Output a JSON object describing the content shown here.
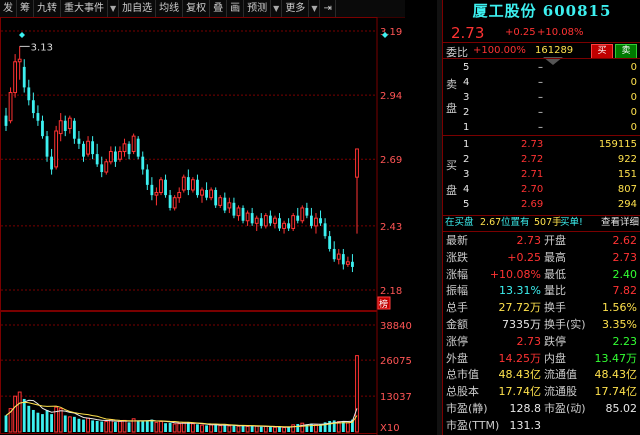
{
  "toolbar": {
    "items": [
      "发",
      "筹",
      "九转",
      "重大事件",
      "",
      "加自选",
      "均线",
      "复权",
      "叠",
      "画",
      "预测",
      "",
      "更多",
      "",
      ""
    ],
    "arrow_down": "▼",
    "more_arrow": "▼",
    "pin_icon": "⇥",
    "dropdown_icon": "▼"
  },
  "chart": {
    "price_labels": [
      "3.19",
      "2.94",
      "2.69",
      "2.43",
      "2.18"
    ],
    "volume_labels": [
      "38840",
      "26075",
      "13037",
      "X10"
    ],
    "max_label": "3.13",
    "badge": "榜"
  },
  "quote": {
    "title": "厦工股份 600815",
    "price": "2.73",
    "change": "+0.25",
    "change_pct": "+10.08%",
    "ratio_label": "委比",
    "ratio_pct": "+100.00%",
    "ratio_vol": "161289",
    "buy_btn": "买",
    "sell_btn": "卖",
    "sell_side": "卖盘",
    "buy_side": "买盘",
    "sell_orders": [
      {
        "level": "5",
        "price": "–",
        "vol": "0"
      },
      {
        "level": "4",
        "price": "–",
        "vol": "0"
      },
      {
        "level": "3",
        "price": "–",
        "vol": "0"
      },
      {
        "level": "2",
        "price": "–",
        "vol": "0"
      },
      {
        "level": "1",
        "price": "–",
        "vol": "0"
      }
    ],
    "buy_orders": [
      {
        "level": "1",
        "price": "2.73",
        "vol": "159115"
      },
      {
        "level": "2",
        "price": "2.72",
        "vol": "922"
      },
      {
        "level": "3",
        "price": "2.71",
        "vol": "151"
      },
      {
        "level": "4",
        "price": "2.70",
        "vol": "807"
      },
      {
        "level": "5",
        "price": "2.69",
        "vol": "294"
      }
    ],
    "notice_prefix": "在买盘",
    "notice_price": "2.67",
    "notice_mid": "位置有",
    "notice_vol": "507手",
    "notice_suffix": "买单!",
    "detail_link": "查看详细",
    "stats": [
      {
        "l1": "最新",
        "v1": "2.73",
        "c1": "red",
        "l2": "开盘",
        "v2": "2.62",
        "c2": "red"
      },
      {
        "l1": "涨跌",
        "v1": "+0.25",
        "c1": "red",
        "l2": "最高",
        "v2": "2.73",
        "c2": "red"
      },
      {
        "l1": "涨幅",
        "v1": "+10.08%",
        "c1": "red",
        "l2": "最低",
        "v2": "2.40",
        "c2": "green"
      },
      {
        "l1": "振幅",
        "v1": "13.31%",
        "c1": "cyan",
        "l2": "量比",
        "v2": "7.82",
        "c2": "red"
      },
      {
        "l1": "总手",
        "v1": "27.72万",
        "c1": "yellow",
        "l2": "换手",
        "v2": "1.56%",
        "c2": "yellow"
      },
      {
        "l1": "金额",
        "v1": "7335万",
        "c1": "white",
        "l2": "换手(实)",
        "v2": "3.35%",
        "c2": "yellow"
      },
      {
        "l1": "涨停",
        "v1": "2.73",
        "c1": "red",
        "l2": "跌停",
        "v2": "2.23",
        "c2": "green"
      },
      {
        "l1": "外盘",
        "v1": "14.25万",
        "c1": "red",
        "l2": "内盘",
        "v2": "13.47万",
        "c2": "green"
      },
      {
        "l1": "总市值",
        "v1": "48.43亿",
        "c1": "yellow",
        "l2": "流通值",
        "v2": "48.43亿",
        "c2": "yellow"
      },
      {
        "l1": "总股本",
        "v1": "17.74亿",
        "c1": "yellow",
        "l2": "流通股",
        "v2": "17.74亿",
        "c2": "yellow"
      },
      {
        "l1": "市盈(静)",
        "v1": "128.8",
        "c1": "white",
        "l2": "市盈(动)",
        "v2": "85.02",
        "c2": "white"
      },
      {
        "l1": "市盈(TTM)",
        "v1": "131.3",
        "c1": "white",
        "l2": "",
        "v2": "",
        "c2": "white"
      }
    ]
  },
  "colors": {
    "up": "#ff3333",
    "down": "#3df0f0",
    "grid": "#7a0000",
    "ma5": "#e8e8e8",
    "ma10": "#ffe24d",
    "ma20": "#ff66ff"
  },
  "chart_data": {
    "type": "candlestick",
    "ylim": [
      2.18,
      3.19
    ],
    "volume_ylim": [
      0,
      38840
    ],
    "candles": [
      {
        "o": 2.86,
        "h": 2.89,
        "l": 2.8,
        "c": 2.82,
        "v": 6000
      },
      {
        "o": 2.84,
        "h": 2.97,
        "l": 2.83,
        "c": 2.95,
        "v": 8500
      },
      {
        "o": 2.95,
        "h": 3.1,
        "l": 2.93,
        "c": 3.07,
        "v": 13000
      },
      {
        "o": 3.07,
        "h": 3.13,
        "l": 3.0,
        "c": 3.08,
        "v": 14500
      },
      {
        "o": 3.05,
        "h": 3.08,
        "l": 2.95,
        "c": 2.97,
        "v": 12000
      },
      {
        "o": 2.97,
        "h": 3.0,
        "l": 2.9,
        "c": 2.92,
        "v": 9500
      },
      {
        "o": 2.92,
        "h": 2.95,
        "l": 2.85,
        "c": 2.87,
        "v": 8000
      },
      {
        "o": 2.87,
        "h": 2.9,
        "l": 2.82,
        "c": 2.84,
        "v": 7000
      },
      {
        "o": 2.84,
        "h": 2.86,
        "l": 2.77,
        "c": 2.78,
        "v": 6500
      },
      {
        "o": 2.78,
        "h": 2.8,
        "l": 2.68,
        "c": 2.7,
        "v": 8000
      },
      {
        "o": 2.7,
        "h": 2.73,
        "l": 2.63,
        "c": 2.65,
        "v": 6500
      },
      {
        "o": 2.66,
        "h": 2.82,
        "l": 2.65,
        "c": 2.8,
        "v": 9000
      },
      {
        "o": 2.79,
        "h": 2.87,
        "l": 2.76,
        "c": 2.84,
        "v": 8500
      },
      {
        "o": 2.84,
        "h": 2.86,
        "l": 2.78,
        "c": 2.8,
        "v": 6000
      },
      {
        "o": 2.81,
        "h": 2.86,
        "l": 2.79,
        "c": 2.85,
        "v": 5500
      },
      {
        "o": 2.84,
        "h": 2.85,
        "l": 2.75,
        "c": 2.77,
        "v": 5500
      },
      {
        "o": 2.77,
        "h": 2.8,
        "l": 2.73,
        "c": 2.75,
        "v": 4800
      },
      {
        "o": 2.75,
        "h": 2.76,
        "l": 2.68,
        "c": 2.7,
        "v": 4500
      },
      {
        "o": 2.71,
        "h": 2.78,
        "l": 2.7,
        "c": 2.76,
        "v": 5000
      },
      {
        "o": 2.76,
        "h": 2.78,
        "l": 2.69,
        "c": 2.71,
        "v": 4200
      },
      {
        "o": 2.71,
        "h": 2.75,
        "l": 2.66,
        "c": 2.67,
        "v": 4000
      },
      {
        "o": 2.67,
        "h": 2.7,
        "l": 2.62,
        "c": 2.64,
        "v": 3800
      },
      {
        "o": 2.64,
        "h": 2.69,
        "l": 2.63,
        "c": 2.68,
        "v": 3800
      },
      {
        "o": 2.68,
        "h": 2.74,
        "l": 2.67,
        "c": 2.72,
        "v": 4500
      },
      {
        "o": 2.72,
        "h": 2.74,
        "l": 2.66,
        "c": 2.68,
        "v": 3600
      },
      {
        "o": 2.69,
        "h": 2.74,
        "l": 2.68,
        "c": 2.72,
        "v": 3900
      },
      {
        "o": 2.72,
        "h": 2.77,
        "l": 2.7,
        "c": 2.75,
        "v": 4200
      },
      {
        "o": 2.75,
        "h": 2.76,
        "l": 2.69,
        "c": 2.71,
        "v": 3500
      },
      {
        "o": 2.72,
        "h": 2.79,
        "l": 2.71,
        "c": 2.78,
        "v": 4800
      },
      {
        "o": 2.77,
        "h": 2.78,
        "l": 2.69,
        "c": 2.7,
        "v": 4000
      },
      {
        "o": 2.7,
        "h": 2.72,
        "l": 2.63,
        "c": 2.65,
        "v": 3800
      },
      {
        "o": 2.65,
        "h": 2.67,
        "l": 2.57,
        "c": 2.59,
        "v": 4200
      },
      {
        "o": 2.59,
        "h": 2.62,
        "l": 2.53,
        "c": 2.55,
        "v": 4500
      },
      {
        "o": 2.55,
        "h": 2.58,
        "l": 2.51,
        "c": 2.56,
        "v": 3500
      },
      {
        "o": 2.56,
        "h": 2.62,
        "l": 2.55,
        "c": 2.61,
        "v": 3800
      },
      {
        "o": 2.61,
        "h": 2.63,
        "l": 2.54,
        "c": 2.55,
        "v": 3200
      },
      {
        "o": 2.55,
        "h": 2.57,
        "l": 2.49,
        "c": 2.5,
        "v": 3300
      },
      {
        "o": 2.5,
        "h": 2.55,
        "l": 2.49,
        "c": 2.54,
        "v": 2900
      },
      {
        "o": 2.54,
        "h": 2.58,
        "l": 2.52,
        "c": 2.56,
        "v": 3000
      },
      {
        "o": 2.57,
        "h": 2.63,
        "l": 2.56,
        "c": 2.62,
        "v": 3400
      },
      {
        "o": 2.62,
        "h": 2.65,
        "l": 2.55,
        "c": 2.57,
        "v": 3600
      },
      {
        "o": 2.57,
        "h": 2.62,
        "l": 2.56,
        "c": 2.61,
        "v": 3000
      },
      {
        "o": 2.61,
        "h": 2.63,
        "l": 2.54,
        "c": 2.55,
        "v": 2800
      },
      {
        "o": 2.55,
        "h": 2.58,
        "l": 2.52,
        "c": 2.57,
        "v": 2500
      },
      {
        "o": 2.57,
        "h": 2.6,
        "l": 2.53,
        "c": 2.54,
        "v": 2400
      },
      {
        "o": 2.54,
        "h": 2.58,
        "l": 2.53,
        "c": 2.57,
        "v": 2600
      },
      {
        "o": 2.57,
        "h": 2.58,
        "l": 2.5,
        "c": 2.51,
        "v": 2700
      },
      {
        "o": 2.51,
        "h": 2.55,
        "l": 2.5,
        "c": 2.54,
        "v": 2300
      },
      {
        "o": 2.54,
        "h": 2.56,
        "l": 2.48,
        "c": 2.49,
        "v": 2500
      },
      {
        "o": 2.5,
        "h": 2.54,
        "l": 2.48,
        "c": 2.52,
        "v": 2200
      },
      {
        "o": 2.52,
        "h": 2.54,
        "l": 2.46,
        "c": 2.47,
        "v": 2400
      },
      {
        "o": 2.47,
        "h": 2.51,
        "l": 2.45,
        "c": 2.5,
        "v": 2100
      },
      {
        "o": 2.5,
        "h": 2.51,
        "l": 2.44,
        "c": 2.45,
        "v": 2300
      },
      {
        "o": 2.45,
        "h": 2.49,
        "l": 2.43,
        "c": 2.48,
        "v": 2000
      },
      {
        "o": 2.48,
        "h": 2.5,
        "l": 2.43,
        "c": 2.44,
        "v": 2200
      },
      {
        "o": 2.44,
        "h": 2.47,
        "l": 2.41,
        "c": 2.46,
        "v": 2100
      },
      {
        "o": 2.46,
        "h": 2.48,
        "l": 2.42,
        "c": 2.43,
        "v": 1900
      },
      {
        "o": 2.43,
        "h": 2.48,
        "l": 2.42,
        "c": 2.47,
        "v": 2000
      },
      {
        "o": 2.47,
        "h": 2.49,
        "l": 2.43,
        "c": 2.44,
        "v": 1800
      },
      {
        "o": 2.44,
        "h": 2.47,
        "l": 2.42,
        "c": 2.46,
        "v": 1700
      },
      {
        "o": 2.46,
        "h": 2.48,
        "l": 2.41,
        "c": 2.42,
        "v": 1800
      },
      {
        "o": 2.42,
        "h": 2.45,
        "l": 2.4,
        "c": 2.44,
        "v": 1600
      },
      {
        "o": 2.44,
        "h": 2.46,
        "l": 2.41,
        "c": 2.42,
        "v": 1700
      },
      {
        "o": 2.42,
        "h": 2.48,
        "l": 2.41,
        "c": 2.47,
        "v": 2600
      },
      {
        "o": 2.47,
        "h": 2.5,
        "l": 2.44,
        "c": 2.45,
        "v": 2900
      },
      {
        "o": 2.45,
        "h": 2.51,
        "l": 2.44,
        "c": 2.5,
        "v": 3200
      },
      {
        "o": 2.5,
        "h": 2.52,
        "l": 2.46,
        "c": 2.47,
        "v": 2800
      },
      {
        "o": 2.47,
        "h": 2.5,
        "l": 2.42,
        "c": 2.43,
        "v": 3000
      },
      {
        "o": 2.43,
        "h": 2.48,
        "l": 2.4,
        "c": 2.46,
        "v": 2500
      },
      {
        "o": 2.46,
        "h": 2.49,
        "l": 2.43,
        "c": 2.44,
        "v": 2700
      },
      {
        "o": 2.44,
        "h": 2.46,
        "l": 2.38,
        "c": 2.39,
        "v": 3500
      },
      {
        "o": 2.39,
        "h": 2.41,
        "l": 2.33,
        "c": 2.34,
        "v": 4000
      },
      {
        "o": 2.34,
        "h": 2.37,
        "l": 2.29,
        "c": 2.3,
        "v": 4200
      },
      {
        "o": 2.3,
        "h": 2.34,
        "l": 2.28,
        "c": 2.32,
        "v": 3800
      },
      {
        "o": 2.32,
        "h": 2.34,
        "l": 2.26,
        "c": 2.28,
        "v": 3700
      },
      {
        "o": 2.28,
        "h": 2.31,
        "l": 2.27,
        "c": 2.29,
        "v": 3300
      },
      {
        "o": 2.29,
        "h": 2.32,
        "l": 2.25,
        "c": 2.27,
        "v": 4500
      },
      {
        "o": 2.62,
        "h": 2.73,
        "l": 2.4,
        "c": 2.73,
        "v": 27720
      }
    ]
  }
}
